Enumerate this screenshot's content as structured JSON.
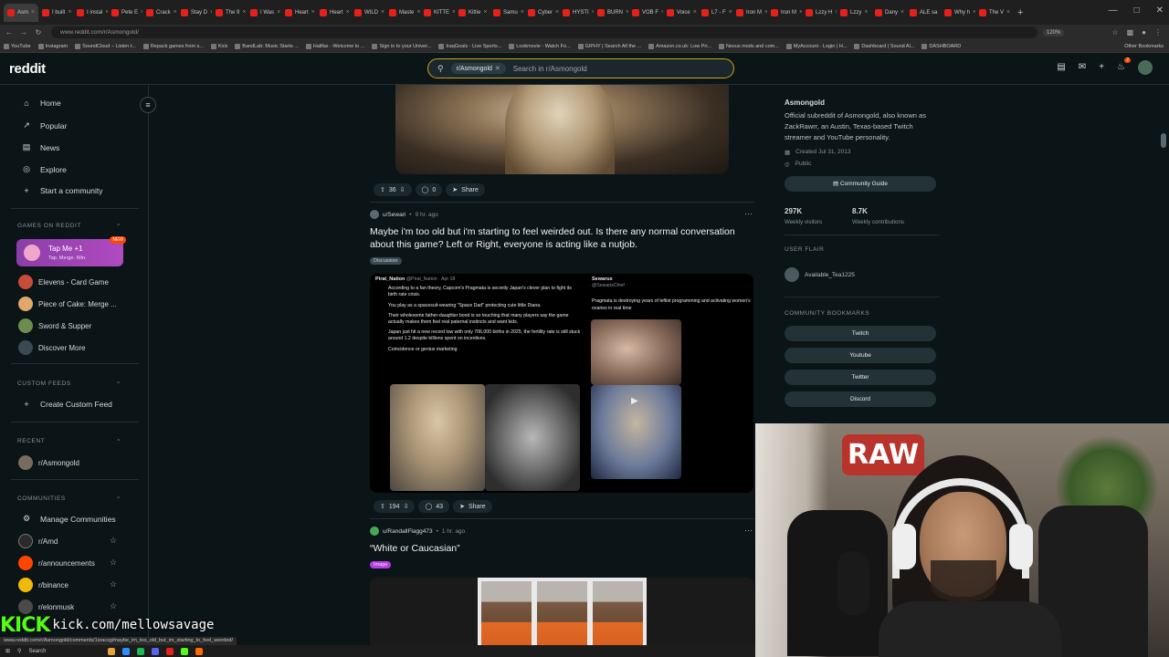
{
  "browser": {
    "tabs": [
      "Asm",
      "I built",
      "I instal",
      "Pete E",
      "Crack",
      "Stay D",
      "The 9",
      "I Was",
      "Heart",
      "Heart",
      "WILD",
      "Maste",
      "KITTE",
      "Kittie",
      "Samu",
      "Cyber",
      "HYSTI",
      "BURN",
      "VOB F",
      "Voice",
      "L7 - F",
      "Iron M",
      "Iron M",
      "Lzzy H",
      "Lzzy",
      "Dany",
      "ALE sa",
      "Why h",
      "The V"
    ],
    "new_tab": "+",
    "url": "www.reddit.com/r/Asmongold/",
    "zoom": "120%",
    "bookmarks": [
      "YouTube",
      "Instagram",
      "SoundCloud – Listen t...",
      "Repack games from s...",
      "Kick",
      "BandLab: Music Starts ...",
      "Halifax - Welcome to ...",
      "Sign in to your Univer...",
      "IraqGoals - Live Sports...",
      "Lookmovie - Watch Fo...",
      "GIPHY | Search All the ...",
      "Amazon.co.uk: Low Pri...",
      "Nexus mods and com...",
      "MyAccount - Login | H...",
      "Dashboard | Sound Al...",
      "DASHBOARD"
    ],
    "other_bookmarks": "Other Bookmarks"
  },
  "header": {
    "logo": "reddit",
    "search_chip": "r/Asmongold",
    "search_placeholder": "Search in r/Asmongold"
  },
  "sidebar": {
    "nav": [
      "Home",
      "Popular",
      "News",
      "Explore",
      "Start a community"
    ],
    "games_header": "GAMES ON REDDIT",
    "tapme_title": "Tap Me +1",
    "tapme_sub": "Tap. Merge. Win.",
    "tapme_badge": "NEW",
    "games": [
      "Elevens - Card Game",
      "Piece of Cake: Merge ...",
      "Sword & Supper",
      "Discover More"
    ],
    "custom_feeds_header": "CUSTOM FEEDS",
    "create_custom_feed": "Create Custom Feed",
    "recent_header": "RECENT",
    "recent": [
      "r/Asmongold"
    ],
    "communities_header": "COMMUNITIES",
    "manage_communities": "Manage Communities",
    "communities": [
      "r/Amd",
      "r/announcements",
      "r/binance",
      "r/elonmusk"
    ]
  },
  "feed": {
    "post1": {
      "votes": "36",
      "comments": "0",
      "share": "Share"
    },
    "post2": {
      "author": "u/Sewari",
      "time": "9 hr. ago",
      "title": "Maybe i'm too old but i'm starting to feel weirded out. Is there any normal conversation about this game? Left or Right, everyone is acting like a nutjob.",
      "flair": "Discussion",
      "votes": "194",
      "comments": "43",
      "share": "Share",
      "tweet_left": {
        "account": "Pirat_Nation",
        "handle": "@Pirat_Nation · Apr 18",
        "lines": [
          "According to a fan theory, Capcom's Pragmata is secretly Japan's clever plan to fight its birth rate crisis.",
          "You play as a spacesuit-wearing \"Space Dad\" protecting cute little Diana.",
          "Their wholesome father-daughter bond is so touching that many players say the game actually makes them feel real paternal instincts and want kids.",
          "Japan just hit a new record low with only 706,000 births in 2025, the fertility rate is still stuck around 1.2 despite billions spent on incentives.",
          "Coincidence or genius marketing"
        ]
      },
      "tweet_right": {
        "account": "Sewarus",
        "handle": "@SewarisChief",
        "line": "Pragmata is destroying years of leftist programming and activating women's ovaries in real time"
      }
    },
    "post3": {
      "author": "u/RandallFlagg473",
      "time": "1 hr. ago",
      "title": "“White or Caucasian”",
      "flair": "Image"
    }
  },
  "community": {
    "name": "Asmongold",
    "description": "Official subreddit of Asmongold, also known as ZackRawrr, an Austin, Texas-based Twitch streamer and YouTube personality.",
    "created": "Created Jul 31, 2013",
    "visibility": "Public",
    "guide_button": "Community Guide",
    "visitors": "297K",
    "visitors_label": "Weekly visitors",
    "contributions": "8.7K",
    "contributions_label": "Weekly contributions",
    "user_flair_header": "USER FLAIR",
    "user_flair": "Available_Tea1225",
    "bookmarks_header": "COMMUNITY BOOKMARKS",
    "bookmarks": [
      "Twitch",
      "Youtube",
      "Twitter",
      "Discord"
    ]
  },
  "overlay": {
    "kick_logo": "KICK",
    "kick_url": "kick.com/mellowsavage",
    "status_url": "www.reddit.com/r/Asmongold/comments/1sracxg/maybe_im_too_old_but_im_starting_to_feel_weirded/",
    "taskbar_search": "Search",
    "cam_sign": "RAW"
  },
  "colors": {
    "accent": "#ff4500",
    "kick_green": "#53fc18",
    "search_border": "#d4a017",
    "background": "#0b1416"
  }
}
